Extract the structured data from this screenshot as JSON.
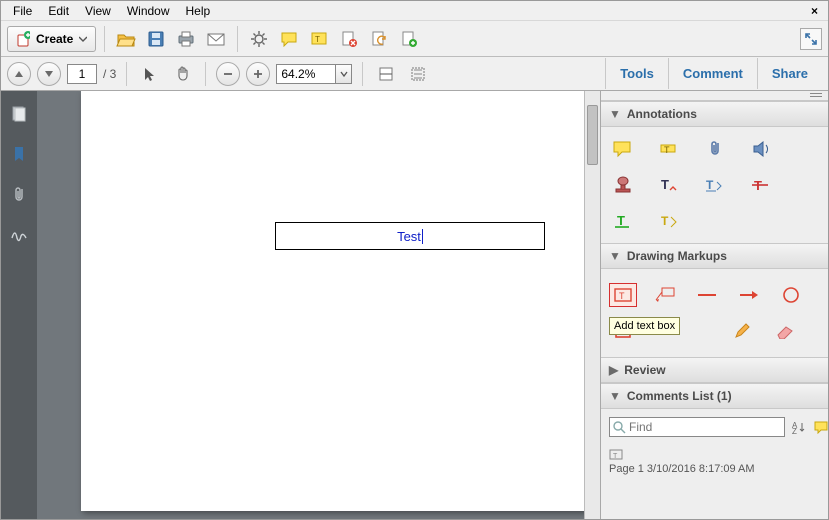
{
  "menu": {
    "items": [
      "File",
      "Edit",
      "View",
      "Window",
      "Help"
    ]
  },
  "create": {
    "label": "Create"
  },
  "page": {
    "current": "1",
    "total": "/ 3"
  },
  "zoom": {
    "value": "64.2%"
  },
  "right_tabs": [
    "Tools",
    "Comment",
    "Share"
  ],
  "panels": {
    "annotations": {
      "title": "Annotations"
    },
    "drawing": {
      "title": "Drawing Markups",
      "tooltip": "Add text box"
    },
    "review": {
      "title": "Review"
    },
    "comments": {
      "title": "Comments List (1)"
    }
  },
  "find": {
    "placeholder": "Find"
  },
  "comment_entry": {
    "meta": "Page 1  3/10/2016 8:17:09 AM"
  },
  "doc": {
    "textbox_value": "Test"
  }
}
